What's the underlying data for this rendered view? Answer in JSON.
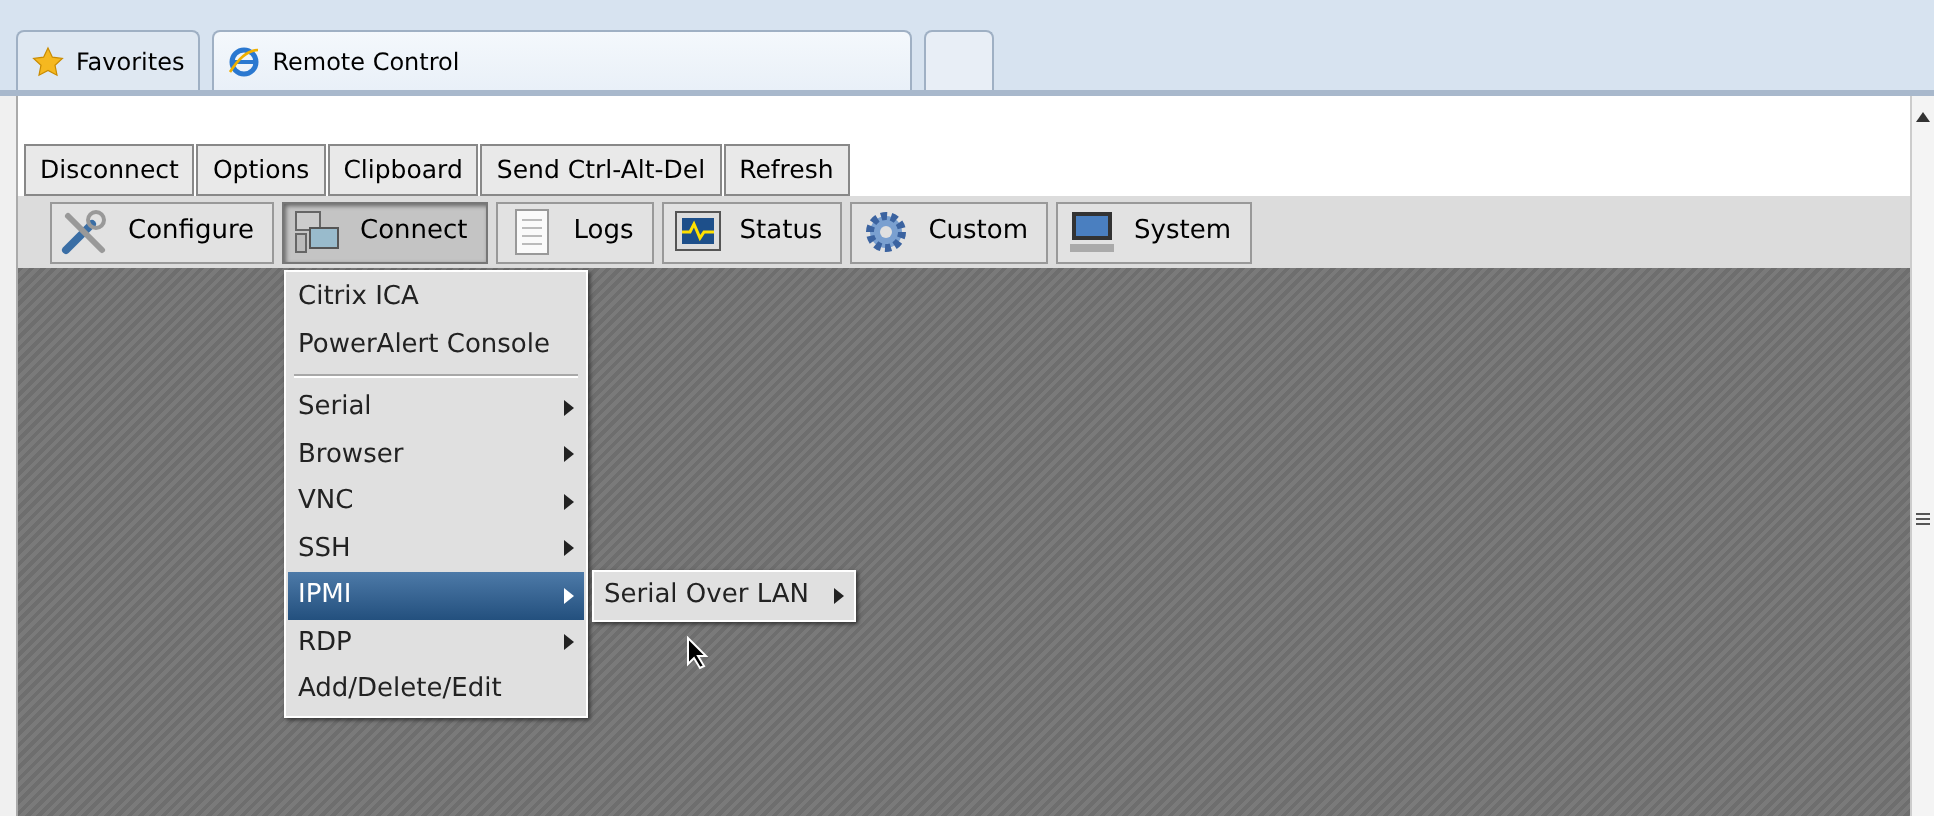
{
  "browser_tabs": [
    {
      "label": "Favorites",
      "kind": "favorites",
      "selected": false
    },
    {
      "label": "Remote Control",
      "kind": "page",
      "selected": true
    },
    {
      "kind": "new",
      "selected": false
    }
  ],
  "toolbar": [
    "Disconnect",
    "Options",
    "Clipboard",
    "Send Ctrl-Alt-Del",
    "Refresh"
  ],
  "nav": [
    {
      "label": "Configure",
      "kind": "tools",
      "selected": false
    },
    {
      "label": "Connect",
      "kind": "computers",
      "selected": true
    },
    {
      "label": "Logs",
      "kind": "document",
      "selected": false
    },
    {
      "label": "Status",
      "kind": "monitor",
      "selected": false
    },
    {
      "label": "Custom",
      "kind": "gear",
      "selected": false
    },
    {
      "label": "System",
      "kind": "computer",
      "selected": false
    }
  ],
  "menu": [
    {
      "kind": "item",
      "label": "Citrix ICA",
      "selected": false
    },
    {
      "kind": "item",
      "label": "PowerAlert Console",
      "selected": false
    },
    {
      "kind": "separator"
    },
    {
      "kind": "submenu",
      "label": "Serial",
      "selected": false
    },
    {
      "kind": "submenu",
      "label": "Browser",
      "selected": false
    },
    {
      "kind": "submenu",
      "label": "VNC",
      "selected": false
    },
    {
      "kind": "submenu",
      "label": "SSH",
      "selected": false
    },
    {
      "kind": "submenu",
      "label": "IPMI",
      "selected": true,
      "children": [
        {
          "kind": "submenu",
          "label": "Serial Over LAN",
          "selected": false
        }
      ]
    },
    {
      "kind": "submenu",
      "label": "RDP",
      "selected": false
    },
    {
      "kind": "item",
      "label": "Add/Delete/Edit",
      "selected": false
    }
  ]
}
